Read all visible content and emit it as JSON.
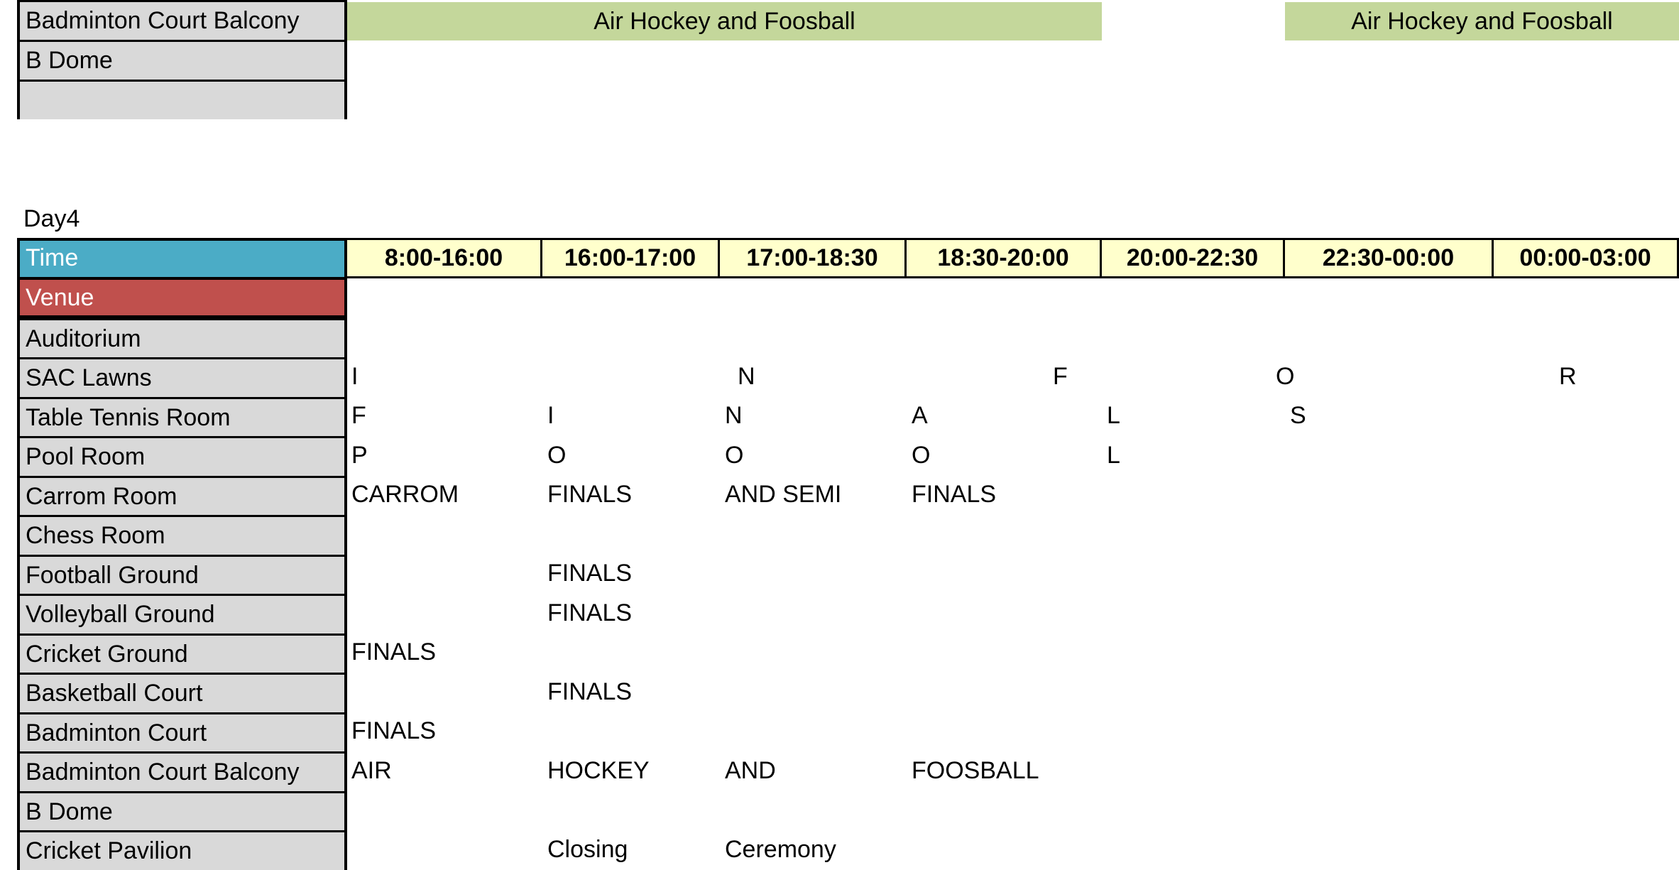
{
  "top_section": {
    "venues": [
      "Badminton Court Balcony",
      "B Dome",
      ""
    ],
    "green_blocks": [
      "Air Hockey and Foosball",
      "Air Hockey and Foosball"
    ]
  },
  "day_label": "Day4",
  "header": {
    "time_label": "Time",
    "venue_label": "Venue",
    "time_slots": [
      "8:00-16:00",
      "16:00-17:00",
      "17:00-18:30",
      "18:30-20:00",
      "20:00-22:30",
      "22:30-00:00",
      "00:00-03:00"
    ]
  },
  "colors": {
    "time_header": "#4bacc6",
    "venue_header": "#c0504d",
    "venue_cell": "#d9d9d9",
    "time_slot": "#ffffcc",
    "green_block": "#c4d79b"
  },
  "rows": [
    {
      "venue": "Auditorium",
      "cells": []
    },
    {
      "venue": "SAC Lawns",
      "cells": [
        "I",
        "N",
        "F",
        "O",
        "R"
      ]
    },
    {
      "venue": "Table Tennis Room",
      "cells": [
        "F",
        "I",
        "N",
        "A",
        "L",
        "S"
      ]
    },
    {
      "venue": "Pool Room",
      "cells": [
        "P",
        "O",
        "O",
        "O",
        "L"
      ]
    },
    {
      "venue": "Carrom Room",
      "cells": [
        "CARROM",
        "FINALS",
        "AND SEMI",
        "FINALS"
      ]
    },
    {
      "venue": "Chess Room",
      "cells": []
    },
    {
      "venue": "Football Ground",
      "cells": [
        "FINALS"
      ]
    },
    {
      "venue": "Volleyball Ground",
      "cells": [
        "FINALS"
      ]
    },
    {
      "venue": "Cricket Ground",
      "cells": [
        "FINALS"
      ]
    },
    {
      "venue": "Basketball Court",
      "cells": [
        "FINALS"
      ]
    },
    {
      "venue": "Badminton Court",
      "cells": [
        "FINALS"
      ]
    },
    {
      "venue": "Badminton Court Balcony",
      "cells": [
        "AIR",
        "HOCKEY",
        "AND",
        "FOOSBALL"
      ]
    },
    {
      "venue": "B Dome",
      "cells": []
    },
    {
      "venue": "Cricket Pavilion",
      "cells": [
        "Closing",
        "Ceremony"
      ]
    }
  ]
}
